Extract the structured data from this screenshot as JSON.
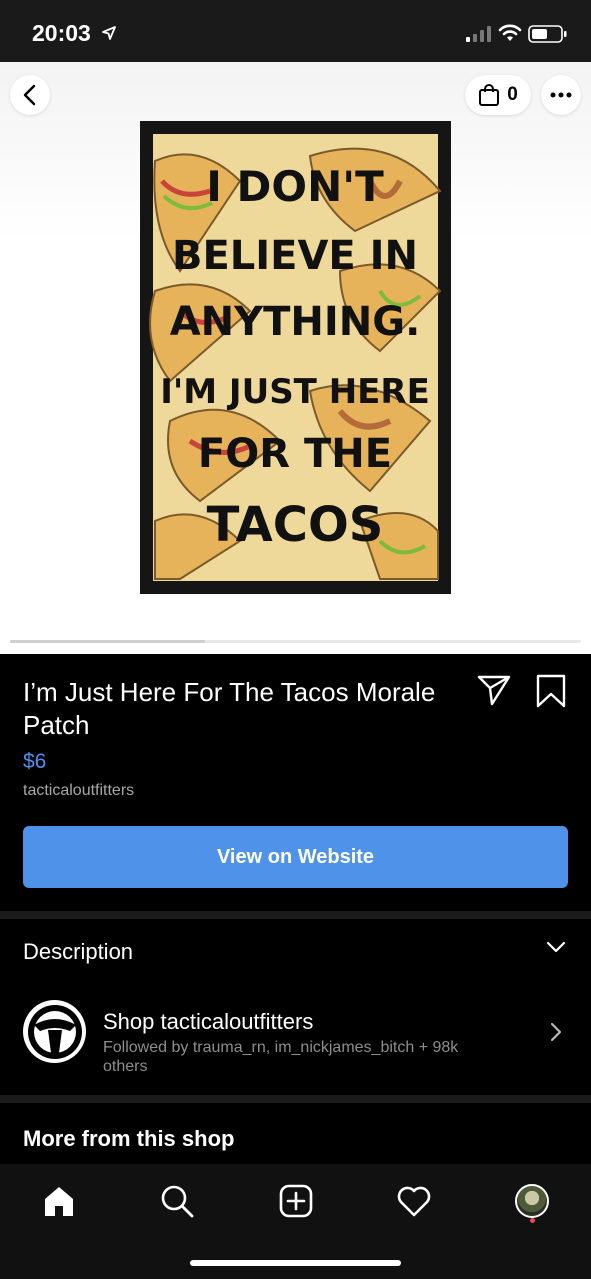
{
  "status_bar": {
    "time": "20:03"
  },
  "header": {
    "cart_count": "0"
  },
  "product_image": {
    "alt": "Morale patch with taco pattern",
    "lines": [
      "I DON'T",
      "BELIEVE IN",
      "ANYTHING.",
      "I'M JUST HERE",
      "FOR THE",
      "TACOS"
    ]
  },
  "product": {
    "title": "I’m Just Here For The Tacos Morale Patch",
    "price": "$6",
    "seller": "tacticaloutfitters",
    "cta_label": "View on Website"
  },
  "description": {
    "label": "Description"
  },
  "shop": {
    "name": "Shop tacticaloutfitters",
    "followers": "Followed by trauma_rn, im_nickjames_bitch + 98k others"
  },
  "more_from_shop": {
    "heading": "More from this shop"
  },
  "colors": {
    "accent": "#4e93e9",
    "price": "#4e8ff0",
    "background": "#000000"
  },
  "icons": [
    "back-icon",
    "bag-icon",
    "more-icon",
    "share-icon",
    "save-icon",
    "chevron-down-icon",
    "chevron-right-icon",
    "home-icon",
    "search-icon",
    "add-icon",
    "heart-icon"
  ]
}
